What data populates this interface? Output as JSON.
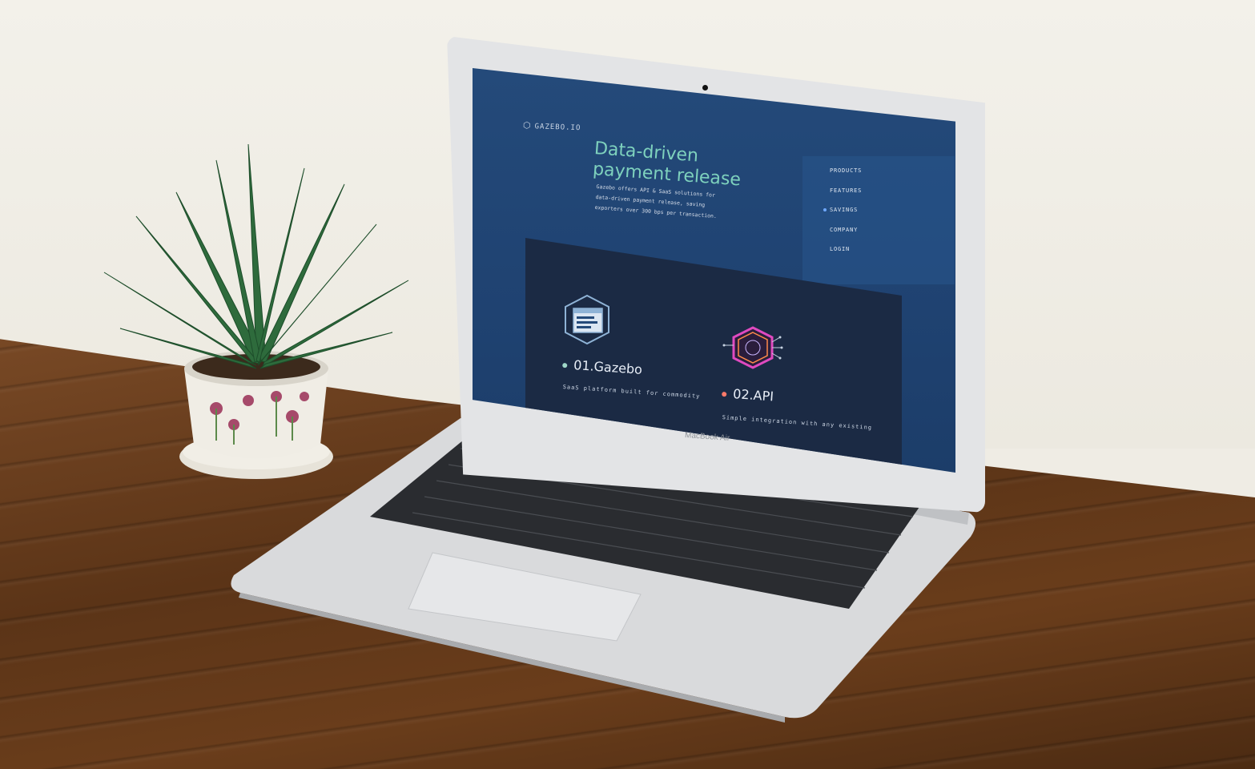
{
  "site": {
    "logo_text": "GAZEBO.IO",
    "headline_line1": "Data-driven",
    "headline_line2": "payment release",
    "subtitle_line1": "Gazebo offers API & SaaS solutions for",
    "subtitle_line2": "data-driven payment release, saving",
    "subtitle_line3": "exporters over 300 bps per transaction."
  },
  "nav": {
    "items": [
      {
        "label": "PRODUCTS"
      },
      {
        "label": "FEATURES"
      },
      {
        "label": "SAVINGS"
      },
      {
        "label": "COMPANY"
      },
      {
        "label": "LOGIN"
      }
    ],
    "active_index": 2
  },
  "features": [
    {
      "title": "01.Gazebo",
      "desc": "SaaS platform built for commodity",
      "dot_color": "#9fd7c8"
    },
    {
      "title": "02.API",
      "desc": "Simple integration with any existing",
      "dot_color": "#ff7a6a"
    }
  ],
  "laptop": {
    "brand_label": "MacBook Air"
  },
  "colors": {
    "screen_bg": "#244a7a",
    "headline": "#7ed1bd",
    "card_bg": "#1b2a44"
  },
  "icons": {
    "logo": "hexagon-icon",
    "feature1": "browser-window-hexagon-icon",
    "feature2": "circuit-hexagon-icon"
  }
}
